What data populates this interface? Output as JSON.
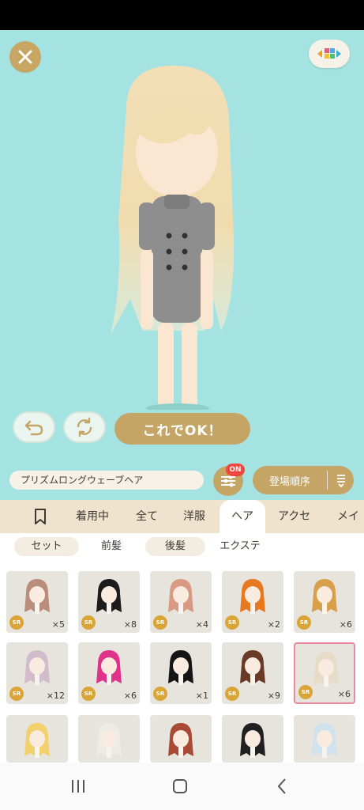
{
  "stage": {
    "ok_label": "これでOK！"
  },
  "toolbar": {
    "item_name": "プリズムロングウェーブヘア",
    "filter_badge": "ON",
    "sort_label": "登場順序"
  },
  "tabs": [
    {
      "label": "着用中"
    },
    {
      "label": "全て"
    },
    {
      "label": "洋服"
    },
    {
      "label": "ヘア"
    },
    {
      "label": "アクセ"
    },
    {
      "label": "メイク"
    }
  ],
  "subtabs": [
    {
      "label": "セット"
    },
    {
      "label": "前髪"
    },
    {
      "label": "後髪"
    },
    {
      "label": "エクステ"
    }
  ],
  "items": [
    {
      "rarity": "SR",
      "count": "×5",
      "color": "#b88d7b"
    },
    {
      "rarity": "SR",
      "count": "×8",
      "color": "#1c1c1c"
    },
    {
      "rarity": "SR",
      "count": "×4",
      "color": "#d99a84"
    },
    {
      "rarity": "SR",
      "count": "×2",
      "color": "#e8781e"
    },
    {
      "rarity": "SR",
      "count": "×6",
      "color": "#d8a04a"
    },
    {
      "rarity": "SR",
      "count": "×12",
      "color": "#d2bccb"
    },
    {
      "rarity": "SR",
      "count": "×6",
      "color": "#e0328a"
    },
    {
      "rarity": "SR",
      "count": "×1",
      "color": "#151515"
    },
    {
      "rarity": "SR",
      "count": "×9",
      "color": "#6a3a26"
    },
    {
      "rarity": "SR",
      "count": "×6",
      "color": "#e6dcc8"
    },
    {
      "rarity": "",
      "count": "",
      "color": "#f2d06a"
    },
    {
      "rarity": "",
      "count": "",
      "color": "#ecebe6"
    },
    {
      "rarity": "",
      "count": "",
      "color": "#a94a36"
    },
    {
      "rarity": "",
      "count": "",
      "color": "#202020"
    },
    {
      "rarity": "",
      "count": "",
      "color": "#cfe2ee"
    }
  ],
  "colors": {
    "accent": "#c4a566",
    "stage_bg": "#a4e3e1",
    "tab_bg": "#efe3cd"
  }
}
